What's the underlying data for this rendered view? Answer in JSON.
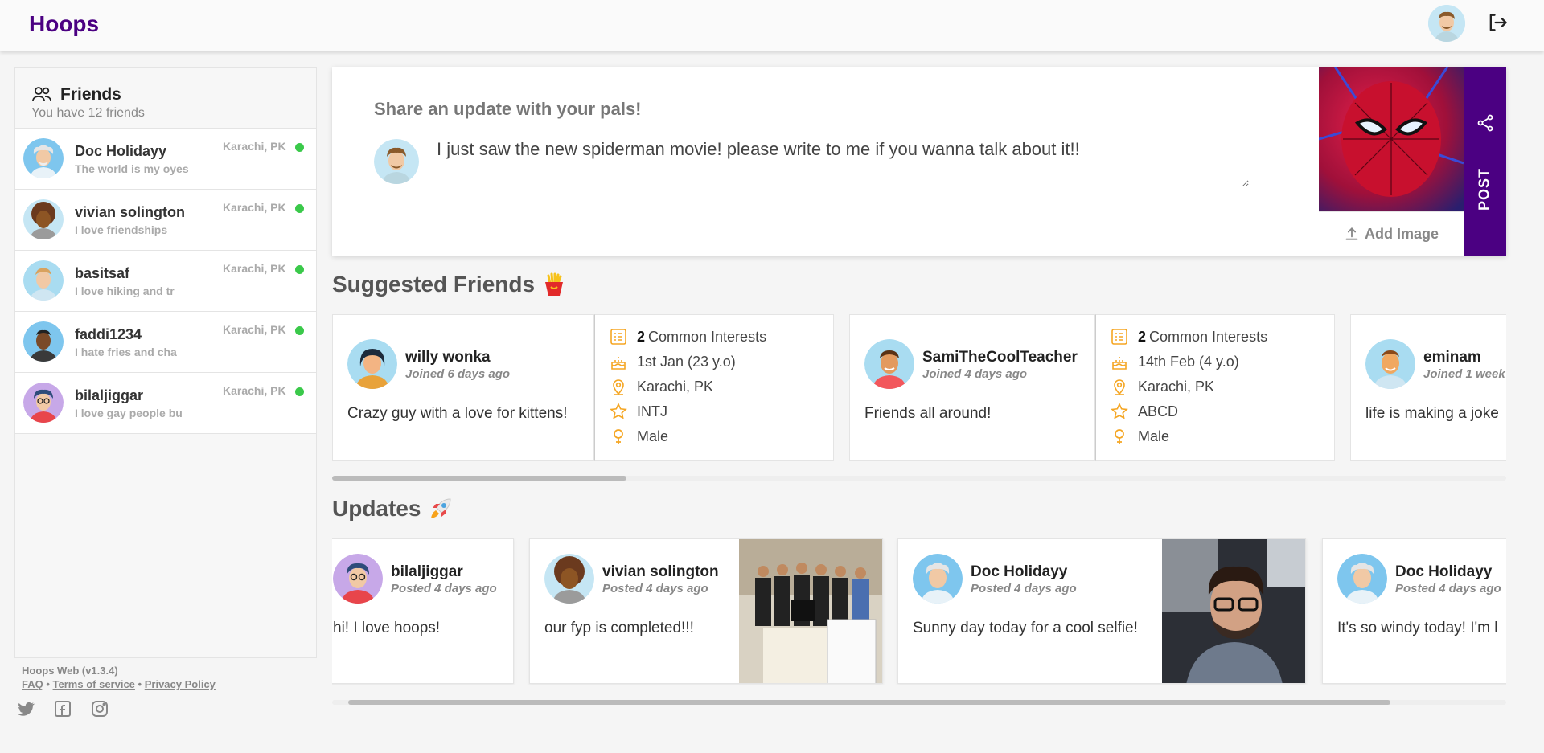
{
  "app": {
    "title": "Hoops"
  },
  "friends": {
    "title": "Friends",
    "subtitle": "You have 12 friends",
    "items": [
      {
        "name": "Doc Holidayy",
        "bio": "The world is my oyes",
        "location": "Karachi, PK"
      },
      {
        "name": "vivian solington",
        "bio": "I love friendships",
        "location": "Karachi, PK"
      },
      {
        "name": "basitsaf",
        "bio": "I love hiking and tr",
        "location": "Karachi, PK"
      },
      {
        "name": "faddi1234",
        "bio": "I hate fries and cha",
        "location": "Karachi, PK"
      },
      {
        "name": "bilaljiggar",
        "bio": "I love gay people bu",
        "location": "Karachi, PK"
      }
    ]
  },
  "footer": {
    "version": "Hoops Web (v1.3.4)",
    "faq": "FAQ",
    "sep": "•",
    "terms": "Terms of service",
    "privacy": "Privacy Policy"
  },
  "composer": {
    "title": "Share an update with your pals!",
    "text": "I just saw the new spiderman movie! please write to me if you wanna talk about it!!",
    "add_image": "Add Image",
    "post": "POST"
  },
  "suggested": {
    "title": "Suggested Friends",
    "cards": [
      {
        "name": "willy wonka",
        "joined": "Joined 6 days ago",
        "bio": "Crazy guy with a love for kittens!",
        "common_count": "2",
        "common_label": "Common Interests",
        "birthday": "1st Jan (23 y.o)",
        "location": "Karachi, PK",
        "personality": "INTJ",
        "gender": "Male"
      },
      {
        "name": "SamiTheCoolTeacher",
        "joined": "Joined 4 days ago",
        "bio": "Friends all around!",
        "common_count": "2",
        "common_label": "Common Interests",
        "birthday": "14th Feb (4 y.o)",
        "location": "Karachi, PK",
        "personality": "ABCD",
        "gender": "Male"
      },
      {
        "name": "eminam",
        "joined": "Joined 1 week",
        "bio": "life is making a joke"
      }
    ]
  },
  "updates": {
    "title": "Updates",
    "posts": [
      {
        "name": "bilaljiggar",
        "time": "Posted 4 days ago",
        "text": "hi! I love hoops!"
      },
      {
        "name": "vivian solington",
        "time": "Posted 4 days ago",
        "text": "our fyp is completed!!!"
      },
      {
        "name": "Doc Holidayy",
        "time": "Posted 4 days ago",
        "text": "Sunny day today for a cool selfie!"
      },
      {
        "name": "Doc Holidayy",
        "time": "Posted 4 days ago",
        "text": "It's so windy today! I'm l"
      }
    ]
  },
  "colors": {
    "brand": "#4b0082",
    "online": "#3ac94a",
    "accent_icon": "#f5a623"
  }
}
